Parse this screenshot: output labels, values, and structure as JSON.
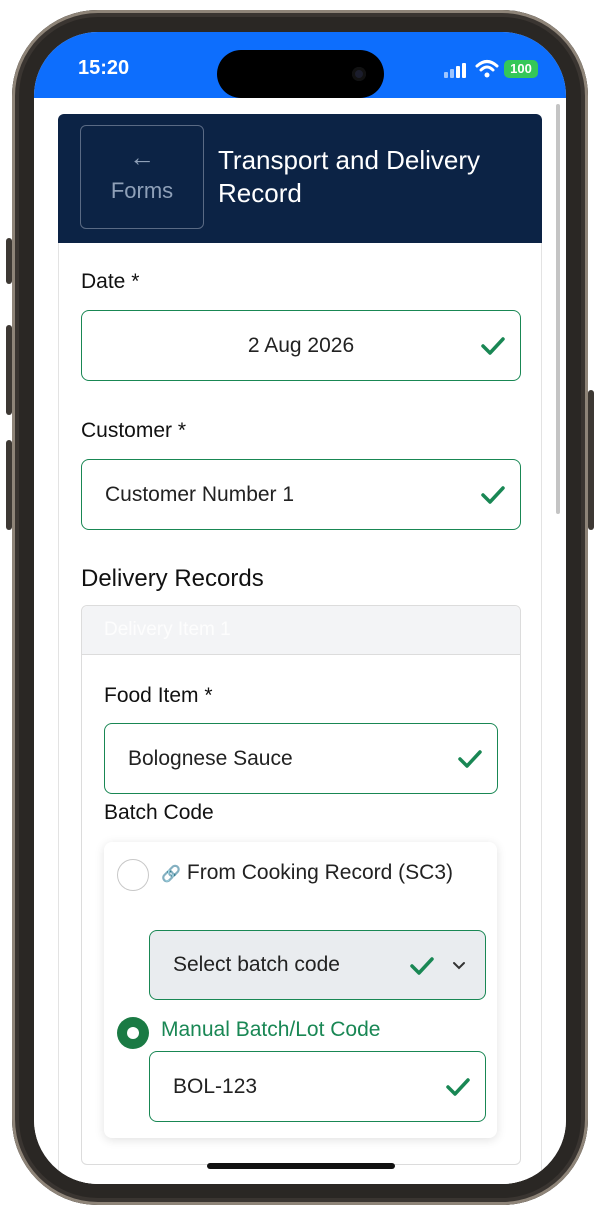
{
  "status": {
    "time": "15:20",
    "battery": "100"
  },
  "header": {
    "back_arrow": "←",
    "back_label": "Forms",
    "title": "Transport and Delivery Record"
  },
  "form": {
    "date_label": "Date *",
    "date_value": "2 Aug 2026",
    "customer_label": "Customer *",
    "customer_value": "Customer Number 1",
    "delivery_section_title": "Delivery Records",
    "delivery_item_title": "Delivery Item 1",
    "food_item_label": "Food Item *",
    "food_item_value": "Bolognese Sauce",
    "batch_code_label": "Batch Code",
    "option_cooking_record_label": "From Cooking Record (SC3)",
    "option_cooking_record_selected": false,
    "batch_select_placeholder": "Select batch code",
    "option_manual_label": "Manual Batch/Lot Code",
    "option_manual_selected": true,
    "manual_code_value": "BOL-123"
  },
  "colors": {
    "status_bar": "#0d6efd",
    "header_bg": "#0c2345",
    "valid_green": "#198754",
    "selected_green": "#1a7a44"
  }
}
